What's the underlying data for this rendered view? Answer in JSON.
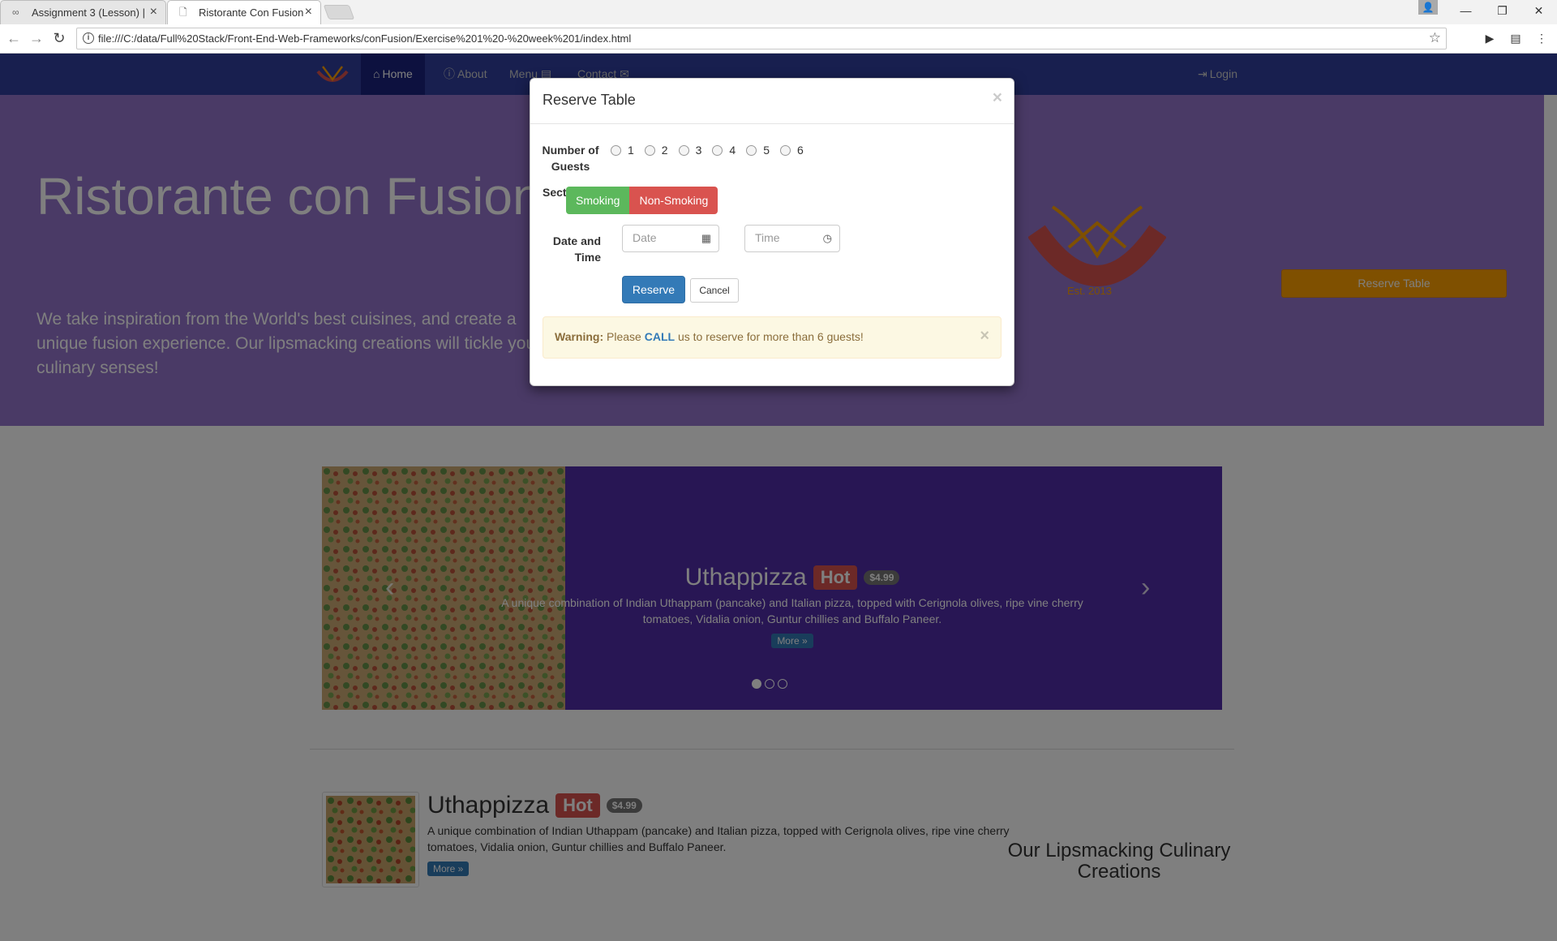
{
  "browser": {
    "tabs": [
      {
        "label": "Assignment 3 (Lesson) | ",
        "icon": "infinity-icon"
      },
      {
        "label": "Ristorante Con Fusion",
        "icon": "page-icon"
      }
    ],
    "url": "file:///C:/data/Full%20Stack/Front-End-Web-Frameworks/conFusion/Exercise%201%20-%20week%201/index.html"
  },
  "nav": {
    "items": [
      {
        "label": "Home",
        "icon": "home-icon"
      },
      {
        "label": "About",
        "icon": "info-icon"
      },
      {
        "label": "Menu",
        "icon": "list-icon"
      },
      {
        "label": "Contact",
        "icon": "envelope-icon"
      }
    ],
    "login": "Login"
  },
  "jumbotron": {
    "title": "Ristorante con Fusion",
    "tagline": "We take inspiration from the World's best cuisines, and create a unique fusion experience. Our lipsmacking creations will tickle your culinary senses!",
    "logo_text": "Ristorante con Fusion",
    "logo_est": "Est. 2013",
    "button": "Reserve Table"
  },
  "carousel": {
    "title": "Uthappizza",
    "label": "Hot",
    "price": "$4.99",
    "description": "A unique combination of Indian Uthappam (pancake) and Italian pizza, topped with Cerignola olives, ripe vine cherry tomatoes, Vidalia onion, Guntur chillies and Buffalo Paneer.",
    "more": "More »",
    "active_slide": 1,
    "slide_count": 3
  },
  "media": {
    "title": "Uthappizza",
    "label": "Hot",
    "price": "$4.99",
    "description": "A unique combination of Indian Uthappam (pancake) and Italian pizza, topped with Cerignola olives, ripe vine cherry tomatoes, Vidalia onion, Guntur chillies and Buffalo Paneer.",
    "more": "More »"
  },
  "side_heading": "Our Lipsmacking Culinary Creations",
  "modal": {
    "title": "Reserve Table",
    "guests_label": "Number of Guests",
    "guest_options": [
      "1",
      "2",
      "3",
      "4",
      "5",
      "6"
    ],
    "section_label": "Section",
    "smoking": "Smoking",
    "non_smoking": "Non-Smoking",
    "datetime_label": "Date and Time",
    "date_placeholder": "Date",
    "time_placeholder": "Time",
    "reserve": "Reserve",
    "cancel": "Cancel",
    "alert": {
      "strong": "Warning:",
      "pre": " Please ",
      "call": "CALL",
      "post": " us to reserve for more than 6 guests!"
    }
  },
  "colors": {
    "navbar": "#303F9F",
    "navbar_active": "#1A237E",
    "jumbotron": "#9575CD",
    "carousel": "#512DA8",
    "accent_button": "#FFA000",
    "success": "#5cb85c",
    "danger": "#d9534f"
  }
}
